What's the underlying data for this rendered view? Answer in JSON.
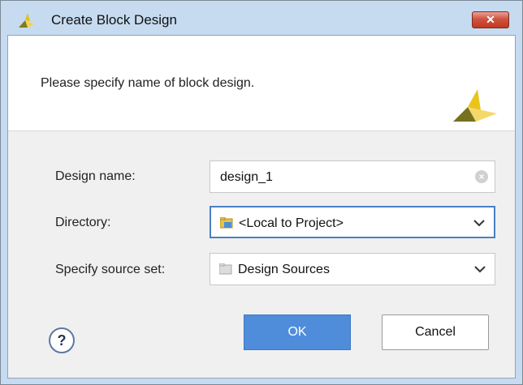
{
  "window": {
    "title": "Create Block Design",
    "close_label": "✕",
    "app_icon": "vivado-logo-icon"
  },
  "header": {
    "message": "Please specify name of block design.",
    "logo_icon": "vivado-logo-icon"
  },
  "form": {
    "design_name": {
      "label": "Design name:",
      "value": "design_1",
      "clear_icon": "clear-icon"
    },
    "directory": {
      "label": "Directory:",
      "value": "<Local to Project>",
      "icon": "project-folder-icon"
    },
    "source_set": {
      "label": "Specify source set:",
      "value": "Design Sources",
      "icon": "folder-icon"
    }
  },
  "buttons": {
    "help_label": "?",
    "ok_label": "OK",
    "cancel_label": "Cancel"
  },
  "colors": {
    "title_bar": "#c6dbf0",
    "accent": "#4f8ddb",
    "focus_border": "#4a7fc4",
    "close_button": "#c2381f"
  }
}
